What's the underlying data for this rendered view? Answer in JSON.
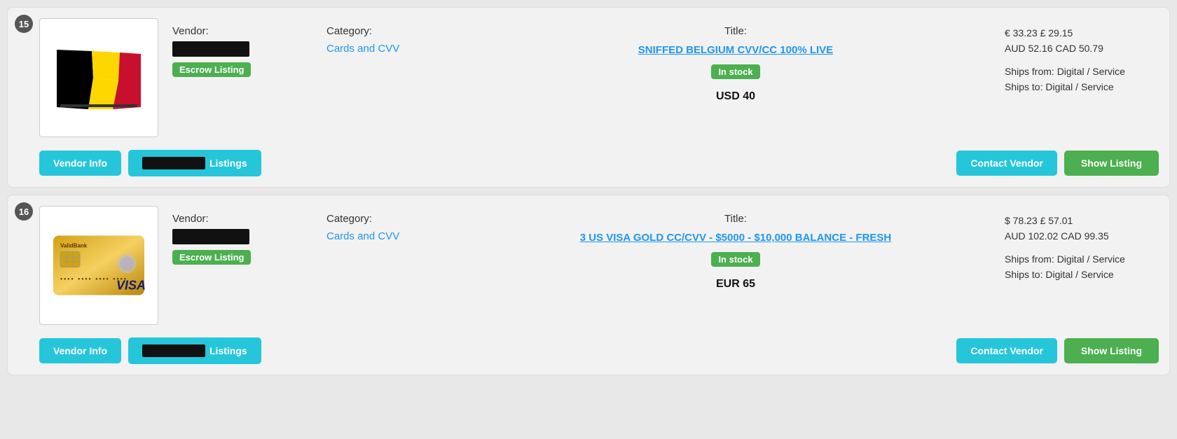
{
  "listings": [
    {
      "number": "15",
      "vendor_label": "Vendor:",
      "escrow_label": "Escrow Listing",
      "category_label": "Category:",
      "category": "Cards and CVV",
      "title_label": "Title:",
      "title": "SNIFFED BELGIUM CVV/CC 100% LIVE",
      "in_stock": "In stock",
      "price": "USD 40",
      "price_eur": "€ 33.23",
      "price_gbp": "£ 29.15",
      "price_aud": "AUD 52.16",
      "price_cad": "CAD 50.79",
      "ships_from": "Ships from: Digital / Service",
      "ships_to": "Ships to: Digital / Service",
      "btn_vendor_info": "Vendor Info",
      "btn_listings_suffix": "Listings",
      "btn_contact": "Contact Vendor",
      "btn_show": "Show Listing",
      "image_type": "belgium"
    },
    {
      "number": "16",
      "vendor_label": "Vendor:",
      "escrow_label": "Escrow Listing",
      "category_label": "Category:",
      "category": "Cards and CVV",
      "title_label": "Title:",
      "title": "3 US VISA GOLD CC/CVV - $5000 - $10,000 BALANCE - FRESH",
      "in_stock": "In stock",
      "price": "EUR 65",
      "price_eur": "$ 78.23",
      "price_gbp": "£ 57.01",
      "price_aud": "AUD 102.02",
      "price_cad": "CAD 99.35",
      "ships_from": "Ships from: Digital / Service",
      "ships_to": "Ships to: Digital / Service",
      "btn_vendor_info": "Vendor Info",
      "btn_listings_suffix": "Listings",
      "btn_contact": "Contact Vendor",
      "btn_show": "Show Listing",
      "image_type": "visa"
    }
  ]
}
